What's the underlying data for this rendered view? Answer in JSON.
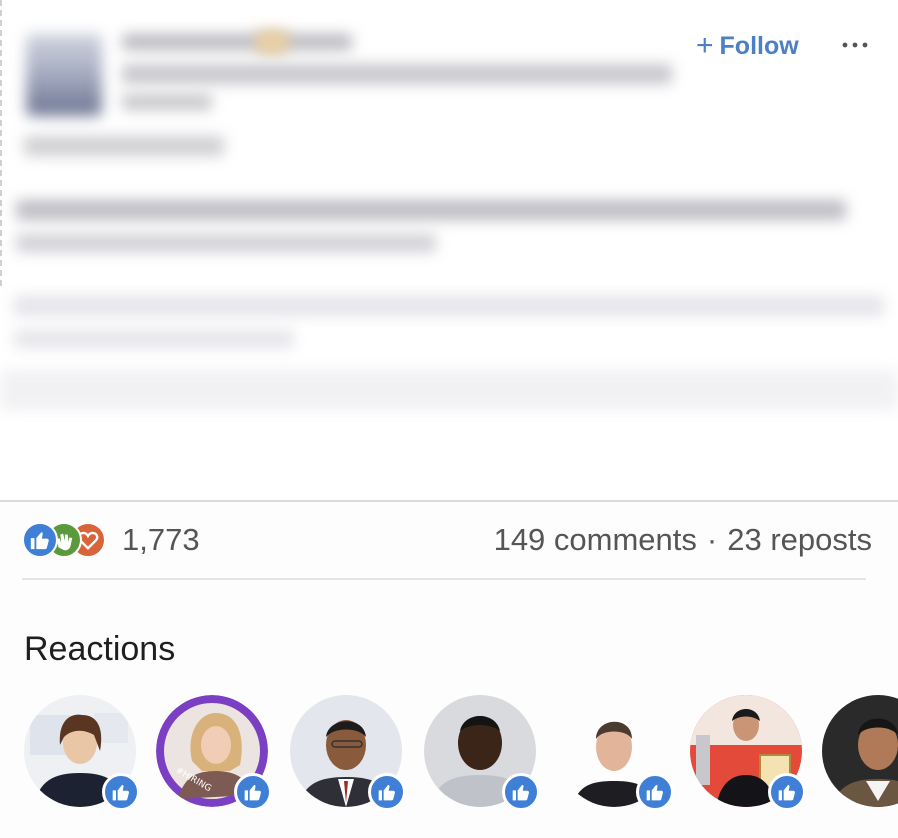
{
  "post": {
    "follow_label": "Follow",
    "follow_plus": "+",
    "more_label": "···"
  },
  "social": {
    "reaction_count": "1,773",
    "comments": "149 comments",
    "separator": "·",
    "reposts": "23 reposts",
    "reaction_types": [
      "like-icon",
      "celebrate-icon",
      "love-icon"
    ]
  },
  "reactions": {
    "title": "Reactions",
    "people": [
      {
        "reaction": "like",
        "ring": "#ffffff"
      },
      {
        "reaction": "like",
        "ring": "#7b3fc4",
        "ring_text": "#HIRING"
      },
      {
        "reaction": "like",
        "ring": "#ffffff"
      },
      {
        "reaction": "like",
        "ring": "#ffffff"
      },
      {
        "reaction": "like",
        "ring": "#ffffff"
      },
      {
        "reaction": "like",
        "ring": "#ffffff"
      },
      {
        "reaction": "none",
        "ring": "#ffffff"
      }
    ]
  },
  "colors": {
    "accent": "#4d7fc4",
    "like": "#3f7fd6",
    "celebrate": "#5a9a3d",
    "love": "#d9643a",
    "hiring_ring": "#7b3fc4"
  }
}
